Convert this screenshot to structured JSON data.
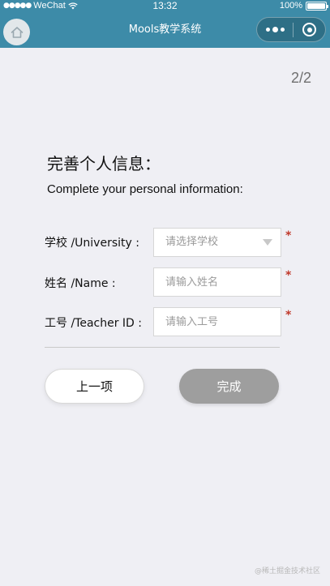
{
  "status_bar": {
    "signal_dots": "●●●●●",
    "carrier": "WeChat",
    "time": "13:32",
    "battery": "100%"
  },
  "nav": {
    "title": "Mools教学系统",
    "color": "#3d8ba8"
  },
  "page_indicator": "2/2",
  "form": {
    "title": "完善个人信息：",
    "subtitle": "Complete your personal information:",
    "fields": [
      {
        "label": "学校 /University :",
        "placeholder": "请选择学校",
        "type": "select",
        "required": "*"
      },
      {
        "label": "姓名 /Name :",
        "placeholder": "请输入姓名",
        "type": "text",
        "required": "*"
      },
      {
        "label": "工号 /Teacher ID :",
        "placeholder": "请输入工号",
        "type": "text",
        "required": "*"
      }
    ]
  },
  "buttons": {
    "prev_label": "上一项",
    "finish_label": "完成"
  },
  "watermark": "@稀土掘金技术社区",
  "colors": {
    "header": "#3d8ba8",
    "background": "#efeff4",
    "required": "#c0392b",
    "finish_button": "#9e9e9e"
  },
  "icons": {
    "home": "home-icon",
    "more": "more-dots-icon",
    "close": "target-close-icon",
    "wifi": "wifi-icon",
    "battery": "battery-icon",
    "dropdown": "chevron-down-icon"
  }
}
